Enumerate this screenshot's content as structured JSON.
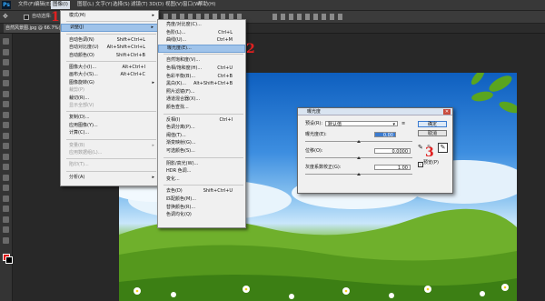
{
  "app": {
    "logo": "Ps"
  },
  "menubar": [
    {
      "label": "文件(F)"
    },
    {
      "label": "编辑(E)"
    },
    {
      "label": "图像(I)"
    },
    {
      "label": "图层(L)"
    },
    {
      "label": "文字(Y)"
    },
    {
      "label": "选择(S)"
    },
    {
      "label": "滤镜(T)"
    },
    {
      "label": "3D(D)"
    },
    {
      "label": "视图(V)"
    },
    {
      "label": "窗口(W)"
    },
    {
      "label": "帮助(H)"
    }
  ],
  "options": {
    "auto_select": "自动选择:"
  },
  "doc_tab": {
    "label": "自然风景图.jpg @ 66.7%(RGB/8)"
  },
  "image_menu": [
    {
      "label": "模式(M)",
      "shortcut": "",
      "submenu": true,
      "disabled": false
    },
    {
      "sep": true
    },
    {
      "label": "调整(J)",
      "shortcut": "",
      "submenu": true,
      "disabled": false,
      "highlight": true
    },
    {
      "sep": true
    },
    {
      "label": "自动色调(N)",
      "shortcut": "Shift+Ctrl+L",
      "disabled": false
    },
    {
      "label": "自动对比度(U)",
      "shortcut": "Alt+Shift+Ctrl+L",
      "disabled": false
    },
    {
      "label": "自动颜色(O)",
      "shortcut": "Shift+Ctrl+B",
      "disabled": false
    },
    {
      "sep": true
    },
    {
      "label": "图像大小(I)...",
      "shortcut": "Alt+Ctrl+I",
      "disabled": false
    },
    {
      "label": "画布大小(S)...",
      "shortcut": "Alt+Ctrl+C",
      "disabled": false
    },
    {
      "label": "图像旋转(G)",
      "shortcut": "",
      "submenu": true,
      "disabled": false
    },
    {
      "label": "裁剪(P)",
      "shortcut": "",
      "disabled": true
    },
    {
      "label": "裁切(R)...",
      "shortcut": "",
      "disabled": false
    },
    {
      "label": "显示全部(V)",
      "shortcut": "",
      "disabled": true
    },
    {
      "sep": true
    },
    {
      "label": "复制(D)...",
      "shortcut": "",
      "disabled": false
    },
    {
      "label": "应用图像(Y)...",
      "shortcut": "",
      "disabled": false
    },
    {
      "label": "计算(C)...",
      "shortcut": "",
      "disabled": false
    },
    {
      "sep": true
    },
    {
      "label": "变量(B)",
      "shortcut": "",
      "submenu": true,
      "disabled": true
    },
    {
      "label": "应用数据组(L)...",
      "shortcut": "",
      "disabled": true
    },
    {
      "sep": true
    },
    {
      "label": "陷印(T)...",
      "shortcut": "",
      "disabled": true
    },
    {
      "sep": true
    },
    {
      "label": "分析(A)",
      "shortcut": "",
      "submenu": true,
      "disabled": false
    }
  ],
  "adjust_menu": [
    {
      "label": "亮度/对比度(C)...",
      "shortcut": ""
    },
    {
      "label": "色阶(L)...",
      "shortcut": "Ctrl+L"
    },
    {
      "label": "曲线(U)...",
      "shortcut": "Ctrl+M"
    },
    {
      "label": "曝光度(E)...",
      "shortcut": "",
      "highlight": true
    },
    {
      "sep": true
    },
    {
      "label": "自然饱和度(V)...",
      "shortcut": ""
    },
    {
      "label": "色相/饱和度(H)...",
      "shortcut": "Ctrl+U"
    },
    {
      "label": "色彩平衡(B)...",
      "shortcut": "Ctrl+B"
    },
    {
      "label": "黑白(K)...",
      "shortcut": "Alt+Shift+Ctrl+B"
    },
    {
      "label": "照片滤镜(F)...",
      "shortcut": ""
    },
    {
      "label": "通道混合器(X)...",
      "shortcut": ""
    },
    {
      "label": "颜色查找...",
      "shortcut": ""
    },
    {
      "sep": true
    },
    {
      "label": "反相(I)",
      "shortcut": "Ctrl+I"
    },
    {
      "label": "色调分离(P)...",
      "shortcut": ""
    },
    {
      "label": "阈值(T)...",
      "shortcut": ""
    },
    {
      "label": "渐变映射(G)...",
      "shortcut": ""
    },
    {
      "label": "可选颜色(S)...",
      "shortcut": ""
    },
    {
      "sep": true
    },
    {
      "label": "阴影/高光(W)...",
      "shortcut": ""
    },
    {
      "label": "HDR 色调...",
      "shortcut": ""
    },
    {
      "label": "变化...",
      "shortcut": ""
    },
    {
      "sep": true
    },
    {
      "label": "去色(D)",
      "shortcut": "Shift+Ctrl+U"
    },
    {
      "label": "匹配颜色(M)...",
      "shortcut": ""
    },
    {
      "label": "替换颜色(R)...",
      "shortcut": ""
    },
    {
      "label": "色调均化(Q)",
      "shortcut": ""
    }
  ],
  "annotations": {
    "one": "1",
    "two": "2",
    "three": "3"
  },
  "dialog": {
    "title": "曝光度",
    "preset_label": "预设(R):",
    "preset_value": "默认值",
    "exposure_label": "曝光度(E):",
    "exposure_value": "0.00",
    "offset_label": "位移(O):",
    "offset_value": "0.0000",
    "gamma_label": "灰度系数校正(G):",
    "gamma_value": "1.00",
    "ok": "确定",
    "cancel": "取消",
    "preview": "预览(P)"
  },
  "colors": {
    "foreground": "#e00000",
    "background": "#000000",
    "accent": "#3b7bd0"
  }
}
